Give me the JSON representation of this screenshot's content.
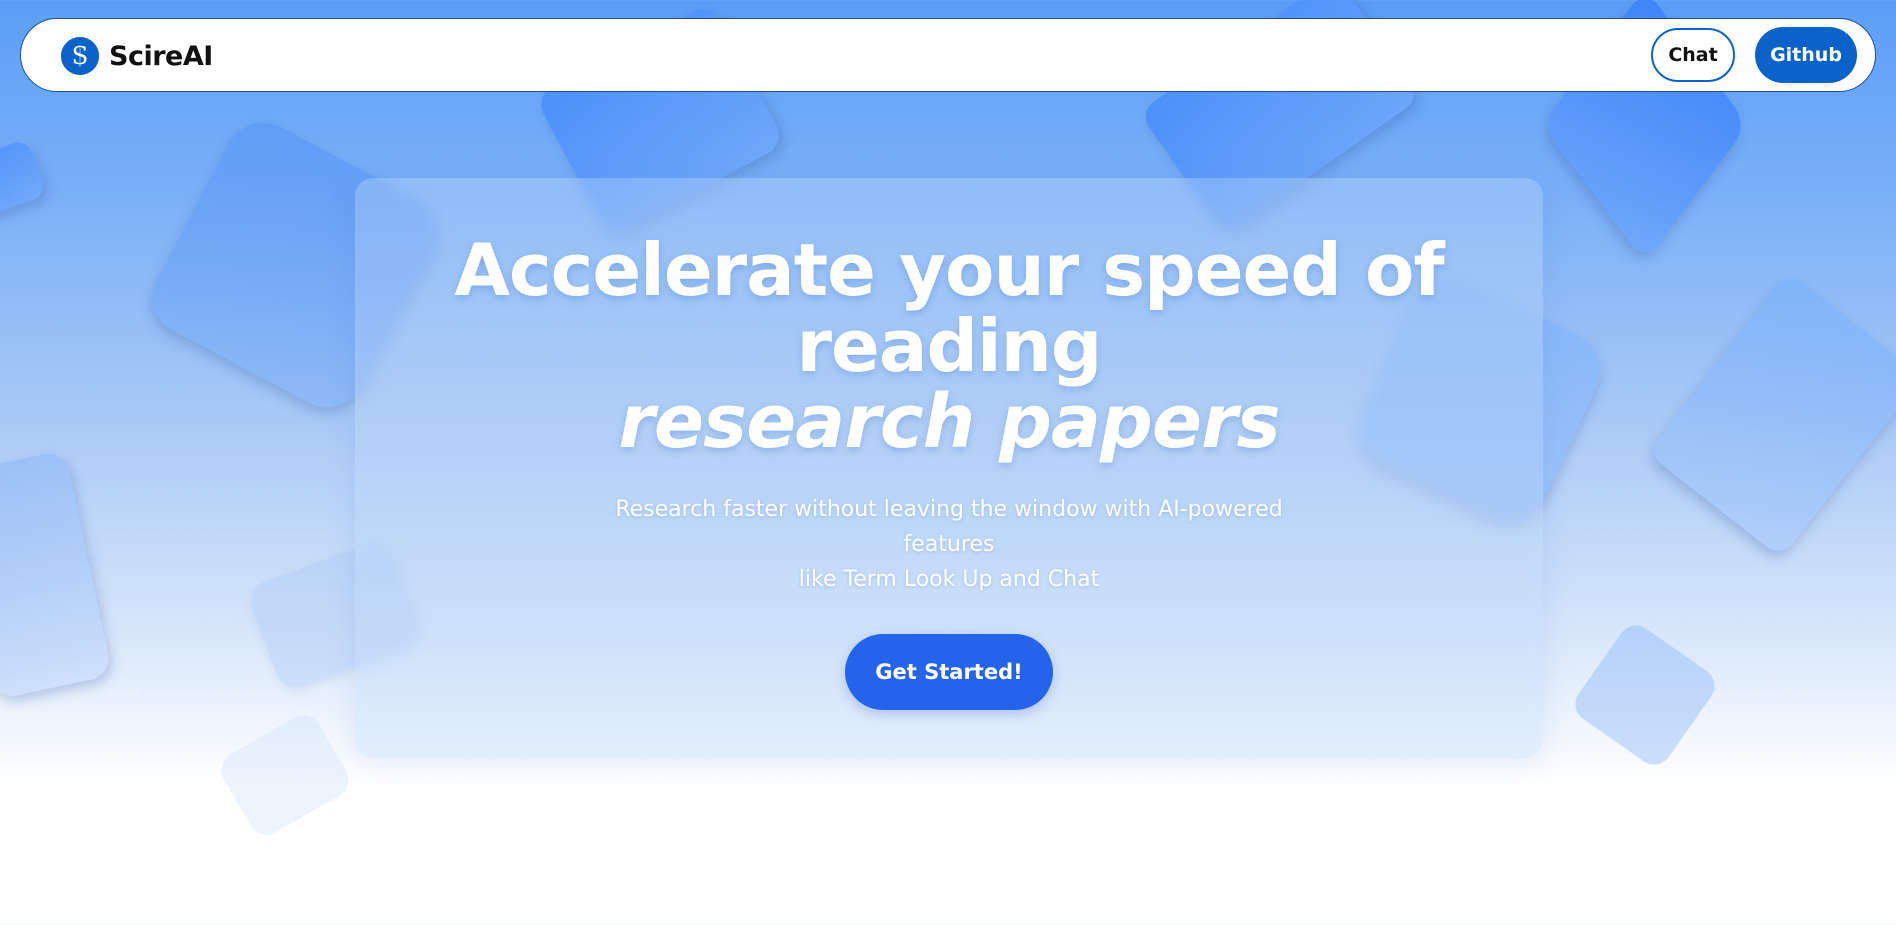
{
  "nav": {
    "brand": "ScireAI",
    "logo_letter": "S",
    "chat_label": "Chat",
    "github_label": "Github"
  },
  "hero": {
    "headline_line1": "Accelerate your speed of",
    "headline_line2": "reading",
    "headline_line3": "research papers",
    "subtitle_line1": "Research faster without leaving the window with AI-powered features",
    "subtitle_line2": "like Term Look Up and Chat",
    "cta_label": "Get Started!"
  },
  "colors": {
    "brand_blue": "#0b63c9",
    "cta_blue": "#2563eb",
    "background_top": "#5b9ef8",
    "background_bottom": "#ffffff"
  }
}
